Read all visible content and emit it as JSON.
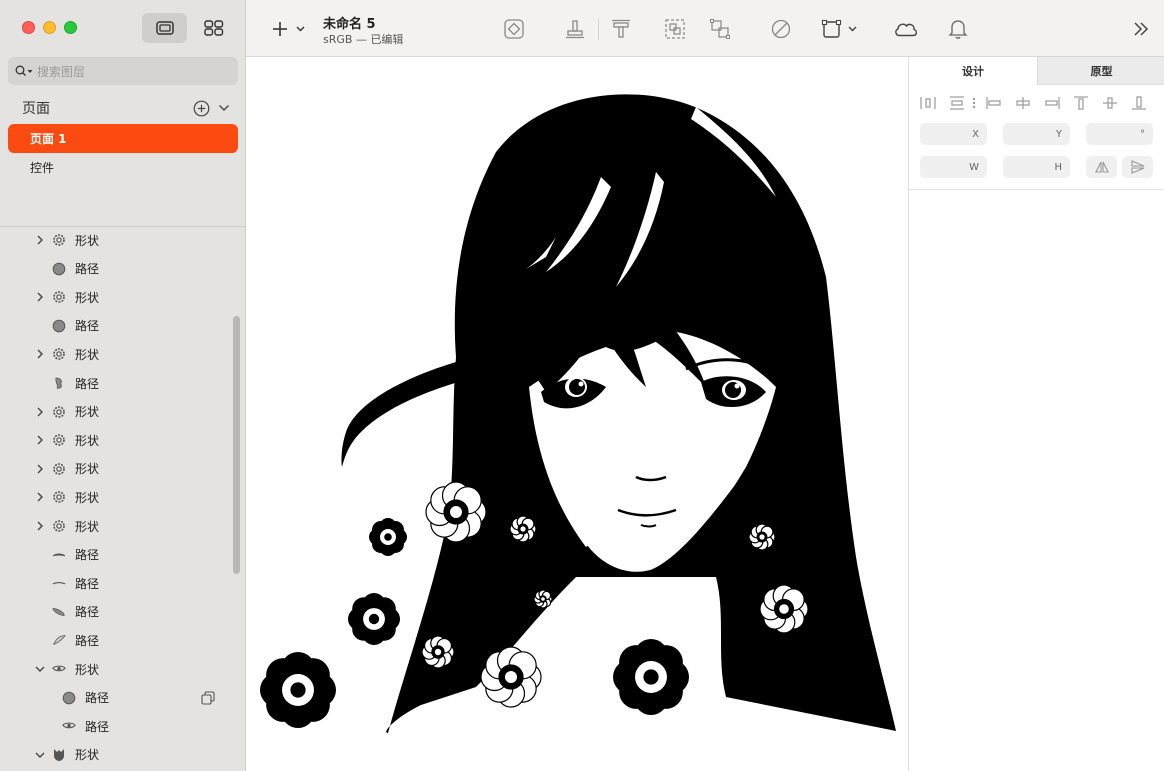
{
  "window": {
    "document_title": "未命名 5",
    "document_subtitle": "sRGB — 已编辑"
  },
  "sidebar": {
    "search_placeholder": "搜索图层",
    "pages_title": "页面",
    "pages": [
      {
        "label": "页面 1",
        "active": true
      },
      {
        "label": "控件",
        "active": false
      }
    ],
    "layers": [
      {
        "label": "形状",
        "type": "group",
        "expanded": false,
        "indent": 0,
        "icon": "gear-shape-icon"
      },
      {
        "label": "路径",
        "type": "path",
        "indent": 0,
        "icon": "circle-path-icon"
      },
      {
        "label": "形状",
        "type": "group",
        "expanded": false,
        "indent": 0,
        "icon": "gear-shape-icon"
      },
      {
        "label": "路径",
        "type": "path",
        "indent": 0,
        "icon": "circle-path-icon"
      },
      {
        "label": "形状",
        "type": "group",
        "expanded": false,
        "indent": 0,
        "icon": "gear-shape-icon"
      },
      {
        "label": "路径",
        "type": "path",
        "indent": 0,
        "icon": "leaf-path-icon"
      },
      {
        "label": "形状",
        "type": "group",
        "expanded": false,
        "indent": 0,
        "icon": "gear-shape-icon"
      },
      {
        "label": "形状",
        "type": "group",
        "expanded": false,
        "indent": 0,
        "icon": "gear-shape-icon"
      },
      {
        "label": "形状",
        "type": "group",
        "expanded": false,
        "indent": 0,
        "icon": "gear-shape-icon"
      },
      {
        "label": "形状",
        "type": "group",
        "expanded": false,
        "indent": 0,
        "icon": "gear-shape-icon"
      },
      {
        "label": "形状",
        "type": "group",
        "expanded": false,
        "indent": 0,
        "icon": "gear-shape-icon"
      },
      {
        "label": "路径",
        "type": "path",
        "indent": 0,
        "icon": "brow-path-icon"
      },
      {
        "label": "路径",
        "type": "path",
        "indent": 0,
        "icon": "line-path-icon"
      },
      {
        "label": "路径",
        "type": "path",
        "indent": 0,
        "icon": "petal-path-icon"
      },
      {
        "label": "路径",
        "type": "path",
        "indent": 0,
        "icon": "slash-path-icon"
      },
      {
        "label": "形状",
        "type": "group",
        "expanded": true,
        "indent": 0,
        "icon": "eye-shape-icon"
      },
      {
        "label": "路径",
        "type": "path",
        "indent": 1,
        "icon": "circle-path-icon",
        "mask": true
      },
      {
        "label": "路径",
        "type": "path",
        "indent": 1,
        "icon": "eye-path-icon"
      },
      {
        "label": "形状",
        "type": "group",
        "expanded": true,
        "indent": 0,
        "icon": "head-shape-icon"
      }
    ]
  },
  "inspector": {
    "tabs": [
      {
        "label": "设计",
        "active": true
      },
      {
        "label": "原型",
        "active": false
      }
    ],
    "fields": {
      "x_label": "X",
      "y_label": "Y",
      "rotation_label": "°",
      "w_label": "W",
      "h_label": "H"
    }
  },
  "colors": {
    "accent": "#fb4b10",
    "sidebar_bg": "#e4e3e2",
    "toolbar_bg": "#f3f2f1"
  }
}
